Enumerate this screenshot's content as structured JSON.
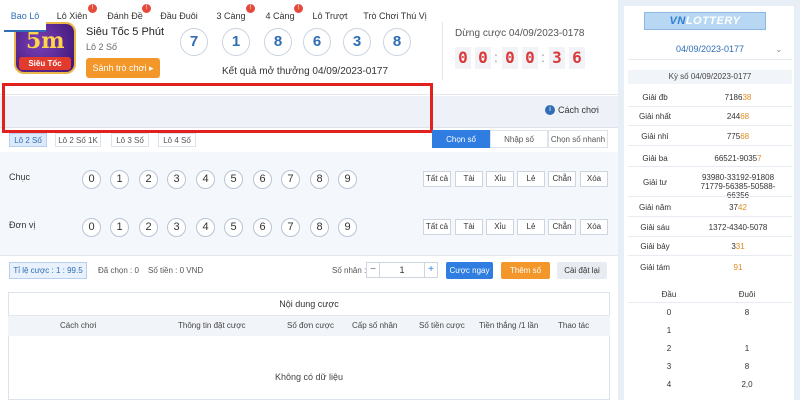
{
  "header": {
    "logo_text": "Siêu Tốc",
    "title": "Siêu Tốc 5 Phút",
    "subtitle": "Lô 2 Số",
    "hall_button": "Sảnh trò chơi ▸",
    "result_balls": [
      "7",
      "1",
      "8",
      "6",
      "3",
      "8"
    ],
    "draw_label": "Kết quả mở thưởng 04/09/2023-0177",
    "stop_label": "Dừng cược 04/09/2023-0178",
    "countdown": [
      "0",
      "0",
      ":",
      "0",
      "0",
      ":",
      "3",
      "6"
    ]
  },
  "tabs": [
    {
      "label": "Bao Lô",
      "hot": false
    },
    {
      "label": "Lô Xiên",
      "hot": true
    },
    {
      "label": "Đánh Đề",
      "hot": true
    },
    {
      "label": "Đầu Đuôi",
      "hot": false
    },
    {
      "label": "3 Càng",
      "hot": true
    },
    {
      "label": "4 Càng",
      "hot": true
    },
    {
      "label": "Lô Trượt",
      "hot": false
    },
    {
      "label": "Trò Chơi Thú Vị",
      "hot": false
    }
  ],
  "howto": "Cách chơi",
  "subtabs": [
    "Lô 2 Số",
    "Lô 2 Số 1K",
    "Lô 3 Số",
    "Lô 4 Số"
  ],
  "modes": [
    "Chọn số",
    "Nhập số",
    "Chọn số nhanh"
  ],
  "rows": [
    {
      "label": "Chục"
    },
    {
      "label": "Đơn vị"
    }
  ],
  "digits": [
    "0",
    "1",
    "2",
    "3",
    "4",
    "5",
    "6",
    "7",
    "8",
    "9"
  ],
  "quick": [
    "Tất cả",
    "Tài",
    "Xỉu",
    "Lẻ",
    "Chẵn",
    "Xóa"
  ],
  "bet": {
    "rate": "Tỉ lệ cược : 1 : 99.5",
    "selected": "Đã chọn : 0",
    "amount": "Số tiền : 0 VND",
    "multiplier_label": "Số nhân :",
    "quantity": "1",
    "bet_now": "Cược ngay",
    "add_numbers": "Thêm số",
    "reset": "Cài đặt lại"
  },
  "table": {
    "title": "Nội dung cược",
    "headers": [
      "Cách chơi",
      "Thông tin đặt cược",
      "Số đơn cược",
      "Cấp số nhân",
      "Số tiền cược",
      "Tiền thắng /1 lần",
      "Thao tác"
    ],
    "empty": "Không có dữ liệu"
  },
  "side": {
    "brand_a": "VN",
    "brand_b": "LOTTERY",
    "period": "04/09/2023-0177",
    "kyso": "Kỳ số 04/09/2023-0177",
    "prizes": [
      {
        "name": "Giải đb",
        "a": "7186",
        "b": "38"
      },
      {
        "name": "Giải nhất",
        "a": "244",
        "b": "68"
      },
      {
        "name": "Giải nhì",
        "a": "775",
        "b": "68"
      },
      {
        "name": "Giải ba",
        "a": "66521-9035",
        "b": "7"
      },
      {
        "name": "Giải tư",
        "a": "93980-33192-91808 71779-56385-50588-66356",
        "b": ""
      },
      {
        "name": "Giải năm",
        "a": "37",
        "b": "42"
      },
      {
        "name": "Giải sáu",
        "a": "1372-4340-5078",
        "b": ""
      },
      {
        "name": "Giải bảy",
        "a": "3",
        "b": "31"
      },
      {
        "name": "Giải tám",
        "a": "",
        "b": "91"
      }
    ],
    "head_tail_header": [
      "Đầu",
      "Đuôi"
    ],
    "head_tail": [
      {
        "d": "0",
        "t": "8"
      },
      {
        "d": "1",
        "t": ""
      },
      {
        "d": "2",
        "t": "1"
      },
      {
        "d": "3",
        "t": "8"
      },
      {
        "d": "4",
        "t": "2,0"
      }
    ]
  }
}
